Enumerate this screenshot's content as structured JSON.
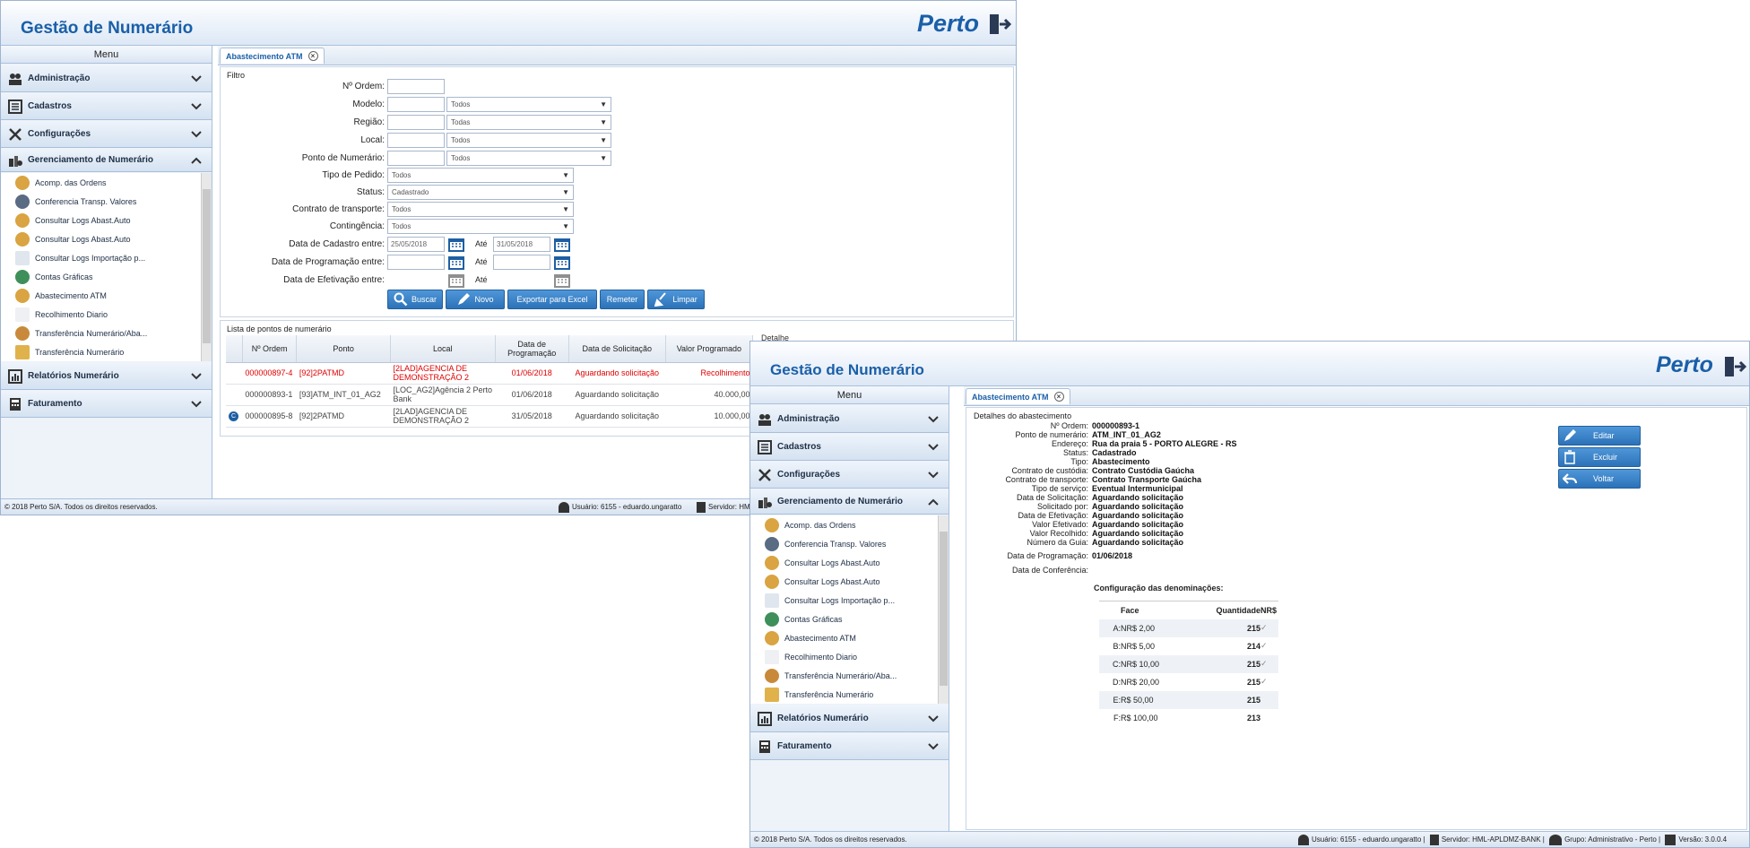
{
  "app_title": "Gestão de Numerário",
  "brand": "Perto",
  "menu_title": "Menu",
  "menu_sections": [
    {
      "label": "Administração"
    },
    {
      "label": "Cadastros"
    },
    {
      "label": "Configurações"
    },
    {
      "label": "Gerenciamento de Numerário"
    },
    {
      "label": "Relatórios Numerário"
    },
    {
      "label": "Faturamento"
    }
  ],
  "menu_items": [
    {
      "label": "Acomp. das Ordens"
    },
    {
      "label": "Conferencia Transp. Valores"
    },
    {
      "label": "Consultar Logs Abast.Auto"
    },
    {
      "label": "Consultar Logs Abast.Auto"
    },
    {
      "label": "Consultar Logs Importação p..."
    },
    {
      "label": "Contas Gráficas"
    },
    {
      "label": "Abastecimento ATM"
    },
    {
      "label": "Recolhimento Diario"
    },
    {
      "label": "Transferência Numerário/Aba..."
    },
    {
      "label": "Transferência Numerário"
    }
  ],
  "tab_label": "Abastecimento ATM",
  "filter": {
    "title": "Filtro",
    "order_label": "Nº Ordem:",
    "model_label": "Modelo:",
    "region_label": "Região:",
    "local_label": "Local:",
    "point_label": "Ponto de Numerário:",
    "order_type_label": "Tipo de Pedido:",
    "status_label": "Status:",
    "contract_label": "Contrato de transporte:",
    "contingency_label": "Contingência:",
    "reg_date_label": "Data de Cadastro entre:",
    "prog_date_label": "Data de Programação entre:",
    "eff_date_label": "Data de Efetivação entre:",
    "until_label": "Até",
    "all": "Todos",
    "all_region": "Todas",
    "status_value": "Cadastrado",
    "reg_from": "25/05/2018",
    "reg_to": "31/05/2018"
  },
  "buttons": {
    "search": "Buscar",
    "new": "Novo",
    "export": "Exportar para Excel",
    "resend": "Remeter",
    "clear": "Limpar"
  },
  "list": {
    "title": "Lista de pontos de numerário",
    "detail_header": "Detalhe",
    "columns": [
      "Nº Ordem",
      "Ponto",
      "Local",
      "Data de Programação",
      "Data de Solicitação",
      "Valor Programado"
    ],
    "rows": [
      {
        "order": "000000897-4",
        "point": "[92]2PATMD",
        "local": "[2LAD]AGENCIA DE DEMONSTRAÇÃO 2",
        "prog": "01/06/2018",
        "req": "Aguardando solicitação",
        "value": "Recolhimento"
      },
      {
        "order": "000000893-1",
        "point": "[93]ATM_INT_01_AG2",
        "local": "[LOC_AG2]Agência 2 Perto Bank",
        "prog": "01/06/2018",
        "req": "Aguardando solicitação",
        "value": "40.000,00"
      },
      {
        "order": "000000895-8",
        "point": "[92]2PATMD",
        "local": "[2LAD]AGENCIA DE DEMONSTRAÇÃO 2",
        "prog": "31/05/2018",
        "req": "Aguardando solicitação",
        "value": "10.000,00"
      }
    ]
  },
  "footer": {
    "copyright": "© 2018 Perto S/A. Todos os direitos reservados.",
    "user": "Usuário: 6155 - eduardo.ungaratto",
    "server_partial": "Servidor: HM",
    "server": "Servidor: HML-APLDMZ-BANK",
    "group": "Grupo: Administrativo - Perto",
    "version": "Versão: 3.0.0.4"
  },
  "details": {
    "title": "Detalhes do abastecimento",
    "fields": [
      {
        "label": "Nº Ordem:",
        "value": "000000893-1"
      },
      {
        "label": "Ponto de numerário:",
        "value": "ATM_INT_01_AG2"
      },
      {
        "label": "Endereço:",
        "value": "Rua da praia 5 - PORTO ALEGRE - RS"
      },
      {
        "label": "Status:",
        "value": "Cadastrado"
      },
      {
        "label": "Tipo:",
        "value": "Abastecimento"
      },
      {
        "label": "Contrato de custódia:",
        "value": "Contrato Custódia Gaúcha"
      },
      {
        "label": "Contrato de transporte:",
        "value": "Contrato Transporte Gaúcha"
      },
      {
        "label": "Tipo de serviço:",
        "value": "Eventual Intermunicipal"
      },
      {
        "label": "Data de Solicitação:",
        "value": "Aguardando solicitação"
      },
      {
        "label": "Solicitado por:",
        "value": "Aguardando solicitação"
      },
      {
        "label": "Data de Efetivação:",
        "value": "Aguardando solicitação"
      },
      {
        "label": "Valor Efetivado:",
        "value": "Aguardando solicitação"
      },
      {
        "label": "Valor Recolhido:",
        "value": "Aguardando solicitação"
      },
      {
        "label": "Número da Guia:",
        "value": "Aguardando solicitação"
      }
    ],
    "prog_label": "Data de Programação:",
    "prog_value": "01/06/2018",
    "conf_label": "Data de Conferência:",
    "denom_title": "Configuração das denominações:",
    "denom_cols": [
      "Face",
      "Quantidade",
      "NR$"
    ],
    "denoms": [
      {
        "slot": "A:",
        "face": "NR$ 2,00",
        "qty": "215"
      },
      {
        "slot": "B:",
        "face": "NR$ 5,00",
        "qty": "214"
      },
      {
        "slot": "C:",
        "face": "NR$ 10,00",
        "qty": "215"
      },
      {
        "slot": "D:",
        "face": "NR$ 20,00",
        "qty": "215"
      },
      {
        "slot": "E:",
        "face": "R$ 50,00",
        "qty": "215"
      },
      {
        "slot": "F:",
        "face": "R$ 100,00",
        "qty": "213"
      }
    ],
    "actions": {
      "edit": "Editar",
      "delete": "Excluir",
      "back": "Voltar"
    }
  }
}
